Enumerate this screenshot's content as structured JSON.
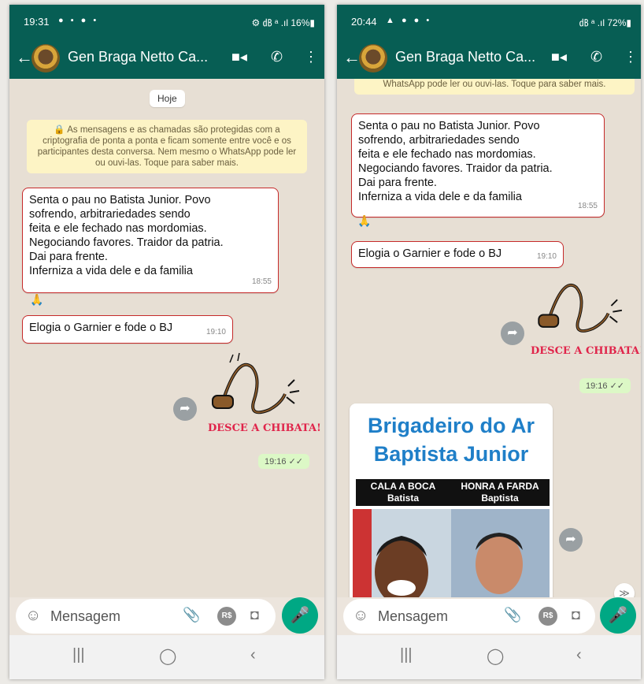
{
  "contact": {
    "name": "Gen Braga Netto Ca..."
  },
  "colors": {
    "header": "#075e54",
    "highlight": "#c62a2a",
    "sent_bubble": "#dcf8c6",
    "mic": "#00a884"
  },
  "icons": {
    "back": "arrow-left-icon",
    "video": "video-icon",
    "call": "phone-icon",
    "menu": "more-vert-icon",
    "emoji": "smiley-icon",
    "attach": "paperclip-icon",
    "payment": "rs-icon",
    "camera": "camera-icon",
    "mic": "mic-icon"
  },
  "left": {
    "status": {
      "time": "19:31",
      "icons": "● ▪ ●  •",
      "right": "⚙ ㏈ ᵃ .ıl 16%▮"
    },
    "date_pill": "Hoje",
    "encryption_notice": "🔒 As mensagens e as chamadas são protegidas com a criptografia de ponta a ponta e ficam somente entre você e os participantes desta conversa. Nem mesmo o WhatsApp pode ler ou ouvi-las. Toque para saber mais.",
    "messages": [
      {
        "text": "Senta o pau no Batista Junior. Povo\nsofrendo, arbitrariedades sendo\nfeita e ele fechado nas mordomias.\nNegociando favores. Traidor da patria.\nDai para frente.\nInferniza a vida dele e da familia",
        "time": "18:55"
      },
      {
        "text": "Elogia o Garnier e fode o BJ",
        "time": "19:10"
      }
    ],
    "reaction": "🙏",
    "sticker": {
      "caption": "DESCE A CHIBATA!",
      "time": "19:16 ✓✓"
    },
    "input_placeholder": "Mensagem"
  },
  "right": {
    "status": {
      "time": "20:44",
      "icons": "▲ ● ● •",
      "right": "㏈ ᵃ .ıl 72%▮"
    },
    "notice_tail": "WhatsApp pode ler ou ouvi-las. Toque para saber mais.",
    "messages": [
      {
        "text": "Senta o pau no Batista Junior. Povo\nsofrendo, arbitrariedades sendo\nfeita e ele fechado nas mordomias.\nNegociando favores. Traidor da patria.\nDai para frente.\nInferniza a vida dele e da familia",
        "time": "18:55"
      },
      {
        "text": "Elogia o Garnier e fode o BJ",
        "time": "19:10"
      }
    ],
    "reaction": "🙏",
    "sticker": {
      "caption": "DESCE A CHIBATA!",
      "time": "19:16 ✓✓"
    },
    "image_card": {
      "headline": "Brigadeiro do Ar\nBaptista Junior",
      "label_left": "CALA A BOCA\nBatista",
      "label_right": "HONRA A FARDA\nBaptista"
    },
    "input_placeholder": "Mensagem"
  },
  "navbar": {
    "recent": "|||",
    "home": "◯",
    "back": "‹"
  }
}
